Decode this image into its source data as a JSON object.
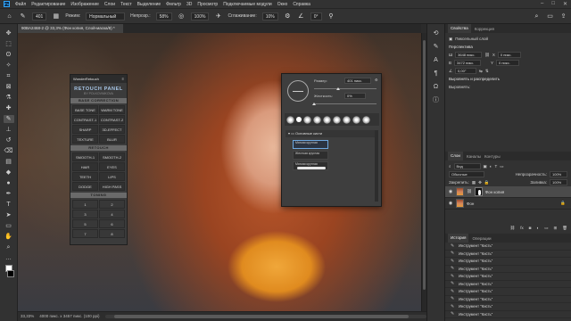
{
  "menu": {
    "logo": "Ps",
    "items": [
      "Файл",
      "Редактирование",
      "Изображение",
      "Слои",
      "Текст",
      "Выделение",
      "Фильтр",
      "3D",
      "Просмотр",
      "Подключаемые модули",
      "Окно",
      "Справка"
    ]
  },
  "options": {
    "brush_size": "401",
    "mode_label": "Режим:",
    "mode_value": "Нормальный",
    "opacity_label": "Непрозр.:",
    "opacity_value": "58%",
    "pressure_value": "100%",
    "smoothing_label": "Сглаживание:",
    "smoothing_value": "10%",
    "angle_value": "0°"
  },
  "document": {
    "tab_title": "90BA2468-2 @ 33,3% (Фон копия, Слой-маска/8) *",
    "status_zoom": "33,33%",
    "status_size": "4000 пикс. x 3457 пикс. (100 ppi)"
  },
  "retouch_panel": {
    "header": "WonderRetouch",
    "title": "RETOUCH PANEL",
    "subtitle": "BY POLKOVNIKOVA",
    "base_section": "BASE CORRECTION",
    "base_buttons": [
      "BASE TONE",
      "WARM TONE",
      "CONTRAST-1",
      "CONTRAST-2",
      "SHARP",
      "3D-EFFECT",
      "TEXTURE",
      "BLUR"
    ],
    "retouch_section": "RETOUCH",
    "retouch_buttons": [
      "SMOOTH-1",
      "SMOOTH-2",
      "HAIR",
      "EYES",
      "TEETH",
      "LIPS",
      "DODGE",
      "HIGH PASS"
    ],
    "toning_section": "TONING",
    "toning_buttons": [
      "1",
      "2",
      "3",
      "4",
      "5",
      "6",
      "7",
      "8"
    ]
  },
  "brush_picker": {
    "size_label": "Размер:",
    "size_value": "401 пикс.",
    "hardness_label": "Жесткость:",
    "hardness_value": "0%",
    "tip_sizes": [
      "30",
      "30",
      "30",
      "25",
      "25",
      "36",
      "25",
      "36"
    ],
    "folder": "Основные кисти",
    "brushes": [
      "Мягкая круглая",
      "Жесткая круглая",
      "Мягкая круглая"
    ]
  },
  "properties": {
    "tabs": [
      "Свойства",
      "Коррекция"
    ],
    "pixel_layer": "Пиксельный слой",
    "transform_title": "Перспектива",
    "w": "3648 пикс.",
    "h": "3472 пикс.",
    "x": "0 пикс.",
    "y": "0 пикс.",
    "angle": "0,00°",
    "align_title": "Выровнять и распределить",
    "align_sub": "Выровнять:"
  },
  "layers": {
    "tabs": [
      "Слои",
      "Каналы",
      "Контуры"
    ],
    "kind": "Вид",
    "blend": "Обычные",
    "opacity_label": "Непрозрачность:",
    "opacity": "100%",
    "lock_label": "Закрепить:",
    "fill_label": "Заливка:",
    "fill": "100%",
    "items": [
      {
        "name": "Фон копия",
        "has_mask": true
      },
      {
        "name": "Фон",
        "has_mask": false
      }
    ]
  },
  "history": {
    "tabs": [
      "История",
      "Операции"
    ],
    "items": [
      "Инструмент \"Кисть\"",
      "Инструмент \"Кисть\"",
      "Инструмент \"Кисть\"",
      "Инструмент \"Кисть\"",
      "Инструмент \"Кисть\"",
      "Инструмент \"Кисть\"",
      "Инструмент \"Кисть\"",
      "Инструмент \"Кисть\"",
      "Инструмент \"Кисть\"",
      "Инструмент \"Кисть\""
    ]
  }
}
